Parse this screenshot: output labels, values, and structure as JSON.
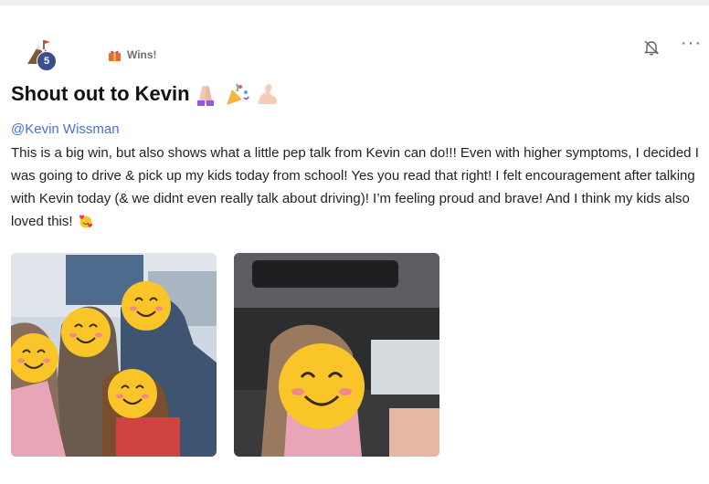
{
  "post": {
    "author_level": "5",
    "category_label": "Wins!",
    "title": "Shout out to Kevin",
    "title_emojis": [
      "folded-hands-emoji",
      "party-popper-emoji",
      "flexed-biceps-emoji"
    ],
    "mention": "@Kevin Wissman",
    "body": "This is a big win, but also shows what a little pep talk from Kevin can do!!! Even with higher symptoms, I decided I was going to drive & pick up my kids today from school! Yes you read that right! I felt encouragement after talking with Kevin today (& we didnt even really talk about driving)! I’m feeling proud and brave! And I think my kids also loved this!",
    "trailing_emoji": "smiling-face-with-hearts-emoji",
    "more_label": "···",
    "photos": [
      "group-selfie-photo",
      "car-selfie-photo"
    ]
  },
  "colors": {
    "mention": "#4a6fd8",
    "badge": "#3b4f8f",
    "face_blur": "#f9c529"
  }
}
